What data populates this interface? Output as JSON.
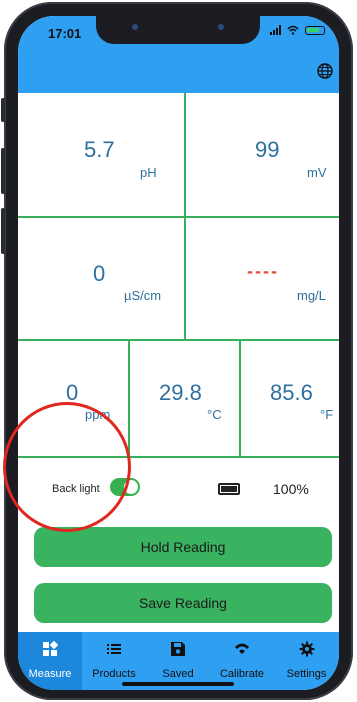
{
  "status_bar": {
    "time": "17:01"
  },
  "readings": {
    "ph": {
      "value": "5.7",
      "unit": "pH"
    },
    "mv": {
      "value": "99",
      "unit": "mV"
    },
    "conductivity": {
      "value": "0",
      "unit": "µS/cm"
    },
    "mgl": {
      "value": "----",
      "unit": "mg/L"
    },
    "ppm": {
      "value": "0",
      "unit": "ppm"
    },
    "celsius": {
      "value": "29.8",
      "unit": "°C"
    },
    "fahrenheit": {
      "value": "85.6",
      "unit": "°F"
    }
  },
  "backlight": {
    "label": "Back light",
    "on": true
  },
  "battery": {
    "percent": "100%"
  },
  "buttons": {
    "hold": "Hold Reading",
    "save": "Save Reading"
  },
  "nav": [
    {
      "label": "Measure",
      "icon": "measure-icon",
      "active": true
    },
    {
      "label": "Products",
      "icon": "list-icon",
      "active": false
    },
    {
      "label": "Saved",
      "icon": "save-icon",
      "active": false
    },
    {
      "label": "Calibrate",
      "icon": "calibrate-icon",
      "active": false
    },
    {
      "label": "Settings",
      "icon": "gear-icon",
      "active": false
    }
  ],
  "colors": {
    "header": "#2f9ff2",
    "grid_line": "#36b05a",
    "button": "#3ab361",
    "value_text": "#2f6f9e",
    "highlight_circle": "#e0281f"
  }
}
